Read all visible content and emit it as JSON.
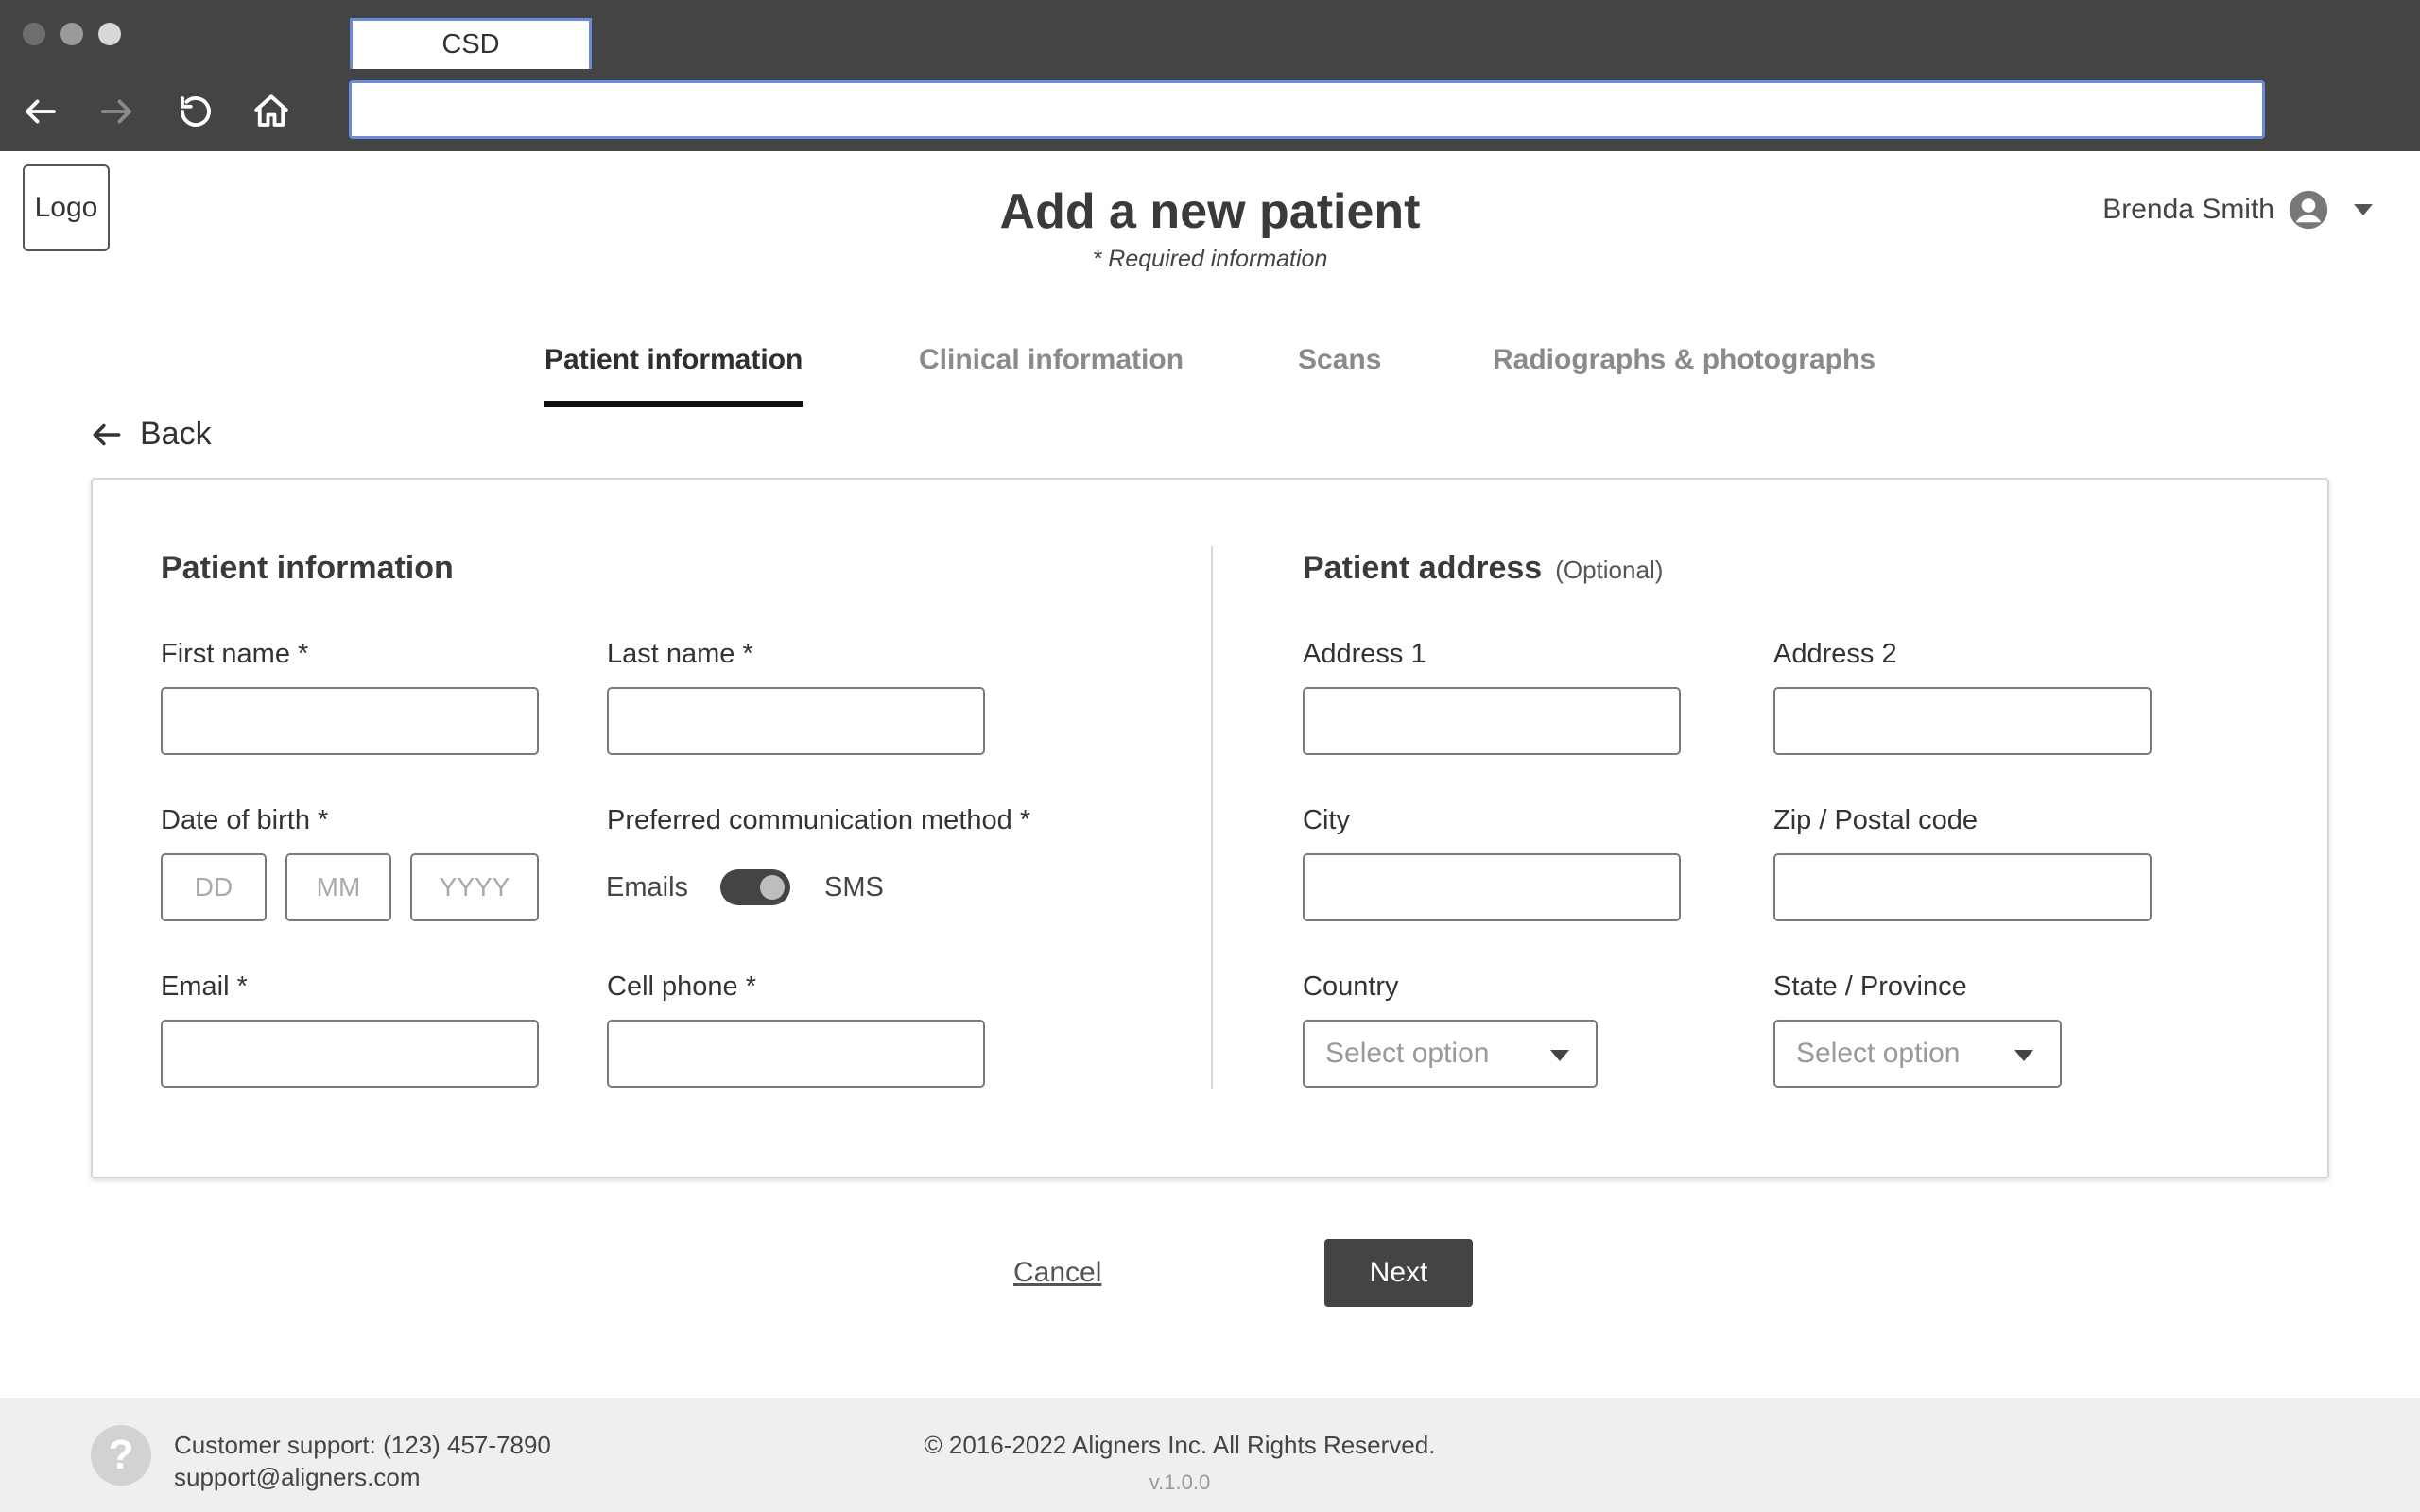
{
  "browser": {
    "tab_title": "CSD",
    "address": ""
  },
  "header": {
    "logo_text": "Logo",
    "title": "Add a new patient",
    "required_note": "* Required information",
    "user_name": "Brenda Smith"
  },
  "tabs": [
    {
      "label": "Patient information",
      "active": true
    },
    {
      "label": "Clinical information",
      "active": false
    },
    {
      "label": "Scans",
      "active": false
    },
    {
      "label": "Radiographs & photographs",
      "active": false
    }
  ],
  "back_label": "Back",
  "patient_info": {
    "title": "Patient information",
    "first_name_label": "First name *",
    "last_name_label": "Last name *",
    "dob_label": "Date of birth *",
    "dob_day_placeholder": "DD",
    "dob_month_placeholder": "MM",
    "dob_year_placeholder": "YYYY",
    "comm_label": "Preferred communication method *",
    "comm_option_left": "Emails",
    "comm_option_right": "SMS",
    "email_label": "Email *",
    "cell_label": "Cell phone *"
  },
  "patient_address": {
    "title": "Patient address",
    "optional": "(Optional)",
    "address1_label": "Address 1",
    "address2_label": "Address 2",
    "city_label": "City",
    "zip_label": "Zip / Postal code",
    "country_label": "Country",
    "country_placeholder": "Select option",
    "state_label": "State / Province",
    "state_placeholder": "Select option"
  },
  "actions": {
    "cancel": "Cancel",
    "next": "Next"
  },
  "footer": {
    "support_phone": "Customer support: (123) 457-7890",
    "support_email": "support@aligners.com",
    "copyright": "© 2016-2022 Aligners Inc. All Rights Reserved.",
    "version": "v.1.0.0",
    "help_glyph": "?"
  }
}
